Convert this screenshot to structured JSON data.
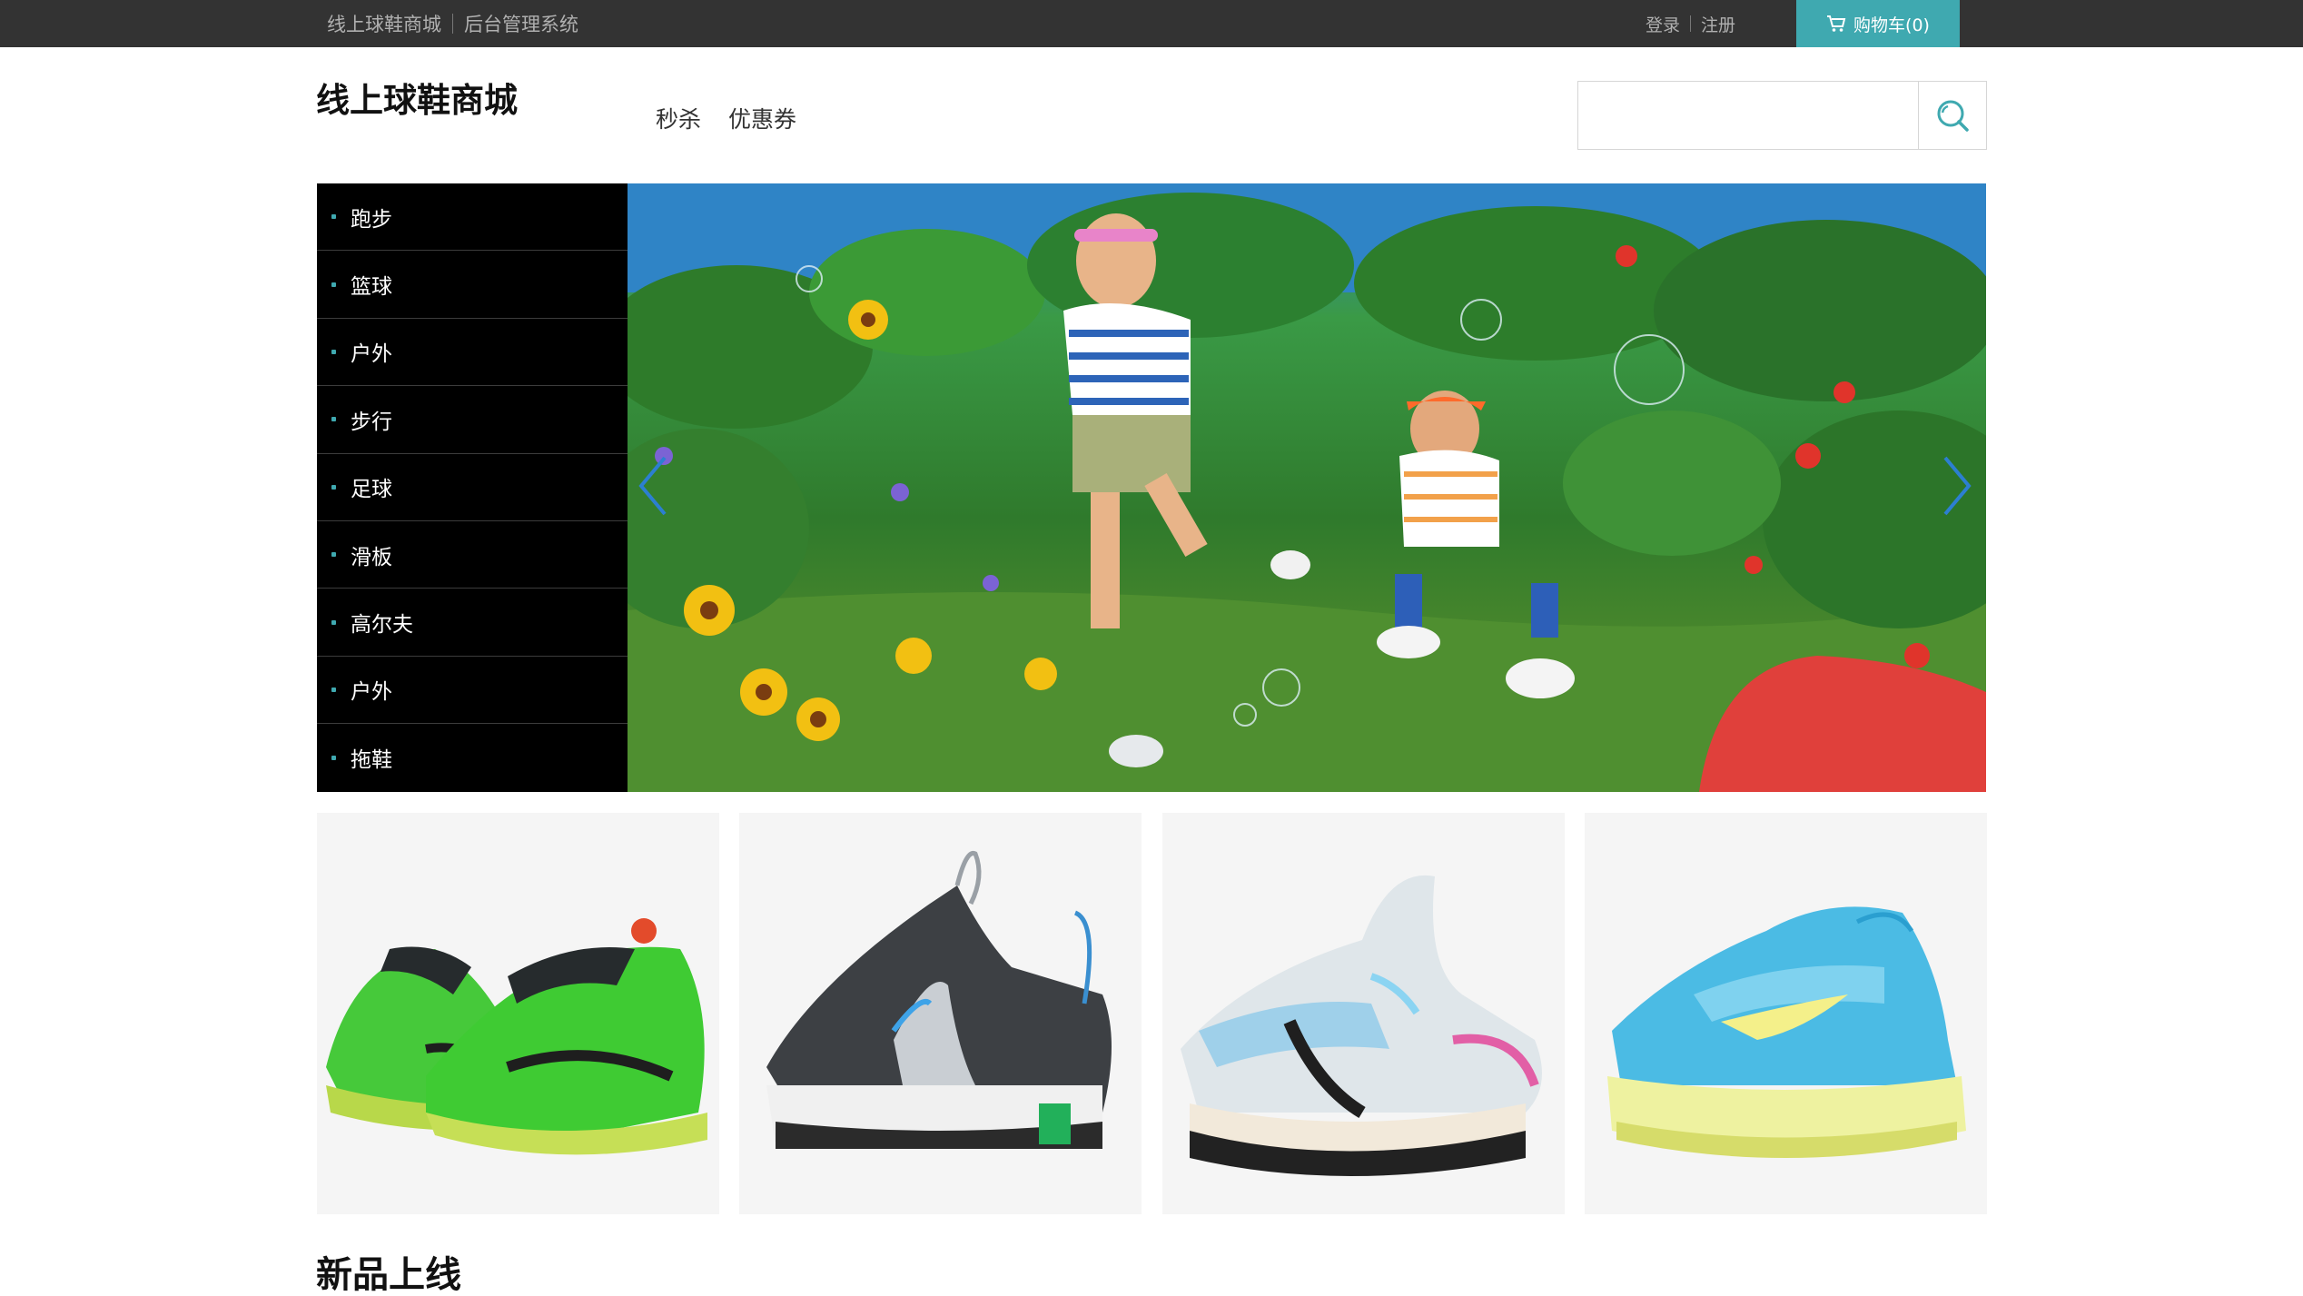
{
  "topbar": {
    "site_link": "线上球鞋商城",
    "admin_link": "后台管理系统",
    "login": "登录",
    "register": "注册",
    "cart": "购物车(0)"
  },
  "header": {
    "logo": "线上球鞋商城",
    "nav": [
      "秒杀",
      "优惠券"
    ],
    "search": {
      "value": "",
      "placeholder": ""
    }
  },
  "categories": [
    "跑步",
    "篮球",
    "户外",
    "步行",
    "足球",
    "滑板",
    "高尔夫",
    "户外",
    "拖鞋"
  ],
  "banner": {
    "slide_count": 1,
    "active_slide": 1
  },
  "products": [
    {
      "icon": "green-racing-shoe-image"
    },
    {
      "icon": "grey-kids-shoe-image"
    },
    {
      "icon": "white-basketball-shoe-image"
    },
    {
      "icon": "blue-airmax-shoe-image"
    }
  ],
  "sections": {
    "new_arrivals": "新品上线"
  },
  "colors": {
    "topbar": "#333333",
    "accent": "#3fa9b0",
    "menu": "#000000"
  }
}
